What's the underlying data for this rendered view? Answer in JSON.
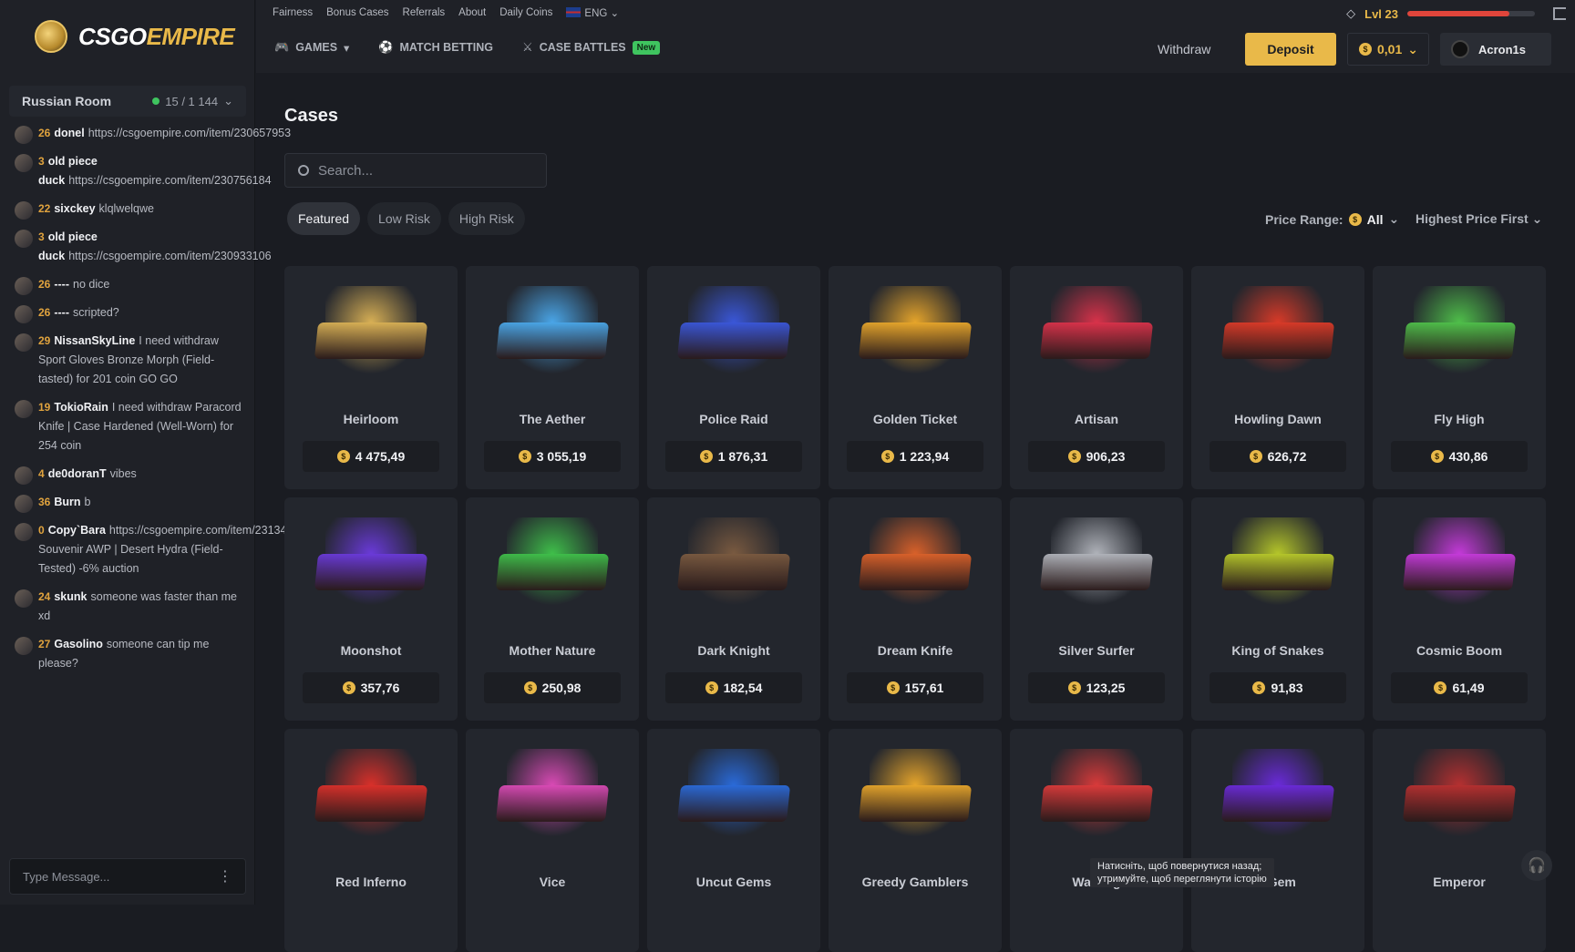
{
  "brand": {
    "part1": "CSGO",
    "part2": "EMPIRE"
  },
  "room": {
    "name": "Russian Room",
    "count": "15 / 1 144"
  },
  "chat": [
    {
      "lvl": "26",
      "user": "donel",
      "text": "https://csgoempire.com/item/230657953"
    },
    {
      "lvl": "3",
      "user": "old piece duck",
      "text": "https://csgoempire.com/item/230756184"
    },
    {
      "lvl": "22",
      "user": "sixckey",
      "text": "klqlwelqwe"
    },
    {
      "lvl": "3",
      "user": "old piece duck",
      "text": "https://csgoempire.com/item/230933106"
    },
    {
      "lvl": "26",
      "user": "----",
      "text": "no dice"
    },
    {
      "lvl": "26",
      "user": "----",
      "text": "scripted?"
    },
    {
      "lvl": "29",
      "user": "NissanSkyLine",
      "text": "I need withdraw Sport Gloves Bronze Morph (Field-tasted) for 201 coin GO GO"
    },
    {
      "lvl": "19",
      "user": "TokioRain",
      "text": "I need withdraw Paracord Knife | Case Hardened (Well-Worn) for 254 coin"
    },
    {
      "lvl": "4",
      "user": "de0doranT",
      "text": "vibes"
    },
    {
      "lvl": "36",
      "user": "Burn",
      "text": "b"
    },
    {
      "lvl": "0",
      "user": "Copy`Bara",
      "text": "https://csgoempire.com/item/231349231 Souvenir AWP | Desert Hydra (Field-Tested) -6% auction"
    },
    {
      "lvl": "24",
      "user": "skunk",
      "text": "someone was faster than me xd"
    },
    {
      "lvl": "27",
      "user": "Gasolino",
      "text": "someone can tip me please?"
    }
  ],
  "chat_input": {
    "placeholder": "Type Message..."
  },
  "toplinks": [
    "Fairness",
    "Bonus Cases",
    "Referrals",
    "About",
    "Daily Coins"
  ],
  "lang": "ENG",
  "level": {
    "label": "Lvl 23",
    "progress": 0.8
  },
  "nav": {
    "games": "GAMES",
    "match": "MATCH BETTING",
    "battles": "CASE BATTLES",
    "new": "New"
  },
  "header": {
    "withdraw": "Withdraw",
    "deposit": "Deposit",
    "balance": "0,01",
    "username": "Acron1s"
  },
  "page": {
    "title": "Cases",
    "search_placeholder": "Search..."
  },
  "filters": [
    "Featured",
    "Low Risk",
    "High Risk"
  ],
  "price_range": {
    "label": "Price Range:",
    "value": "All"
  },
  "sort": "Highest Price First",
  "cases": [
    {
      "name": "Heirloom",
      "price": "4 475,49",
      "color": "#d8b055"
    },
    {
      "name": "The Aether",
      "price": "3 055,19",
      "color": "#4aa6e8"
    },
    {
      "name": "Police Raid",
      "price": "1 876,31",
      "color": "#3a57d9"
    },
    {
      "name": "Golden Ticket",
      "price": "1 223,94",
      "color": "#e6a52b"
    },
    {
      "name": "Artisan",
      "price": "906,23",
      "color": "#d9324a"
    },
    {
      "name": "Howling Dawn",
      "price": "626,72",
      "color": "#d93a28"
    },
    {
      "name": "Fly High",
      "price": "430,86",
      "color": "#4fbf4a"
    },
    {
      "name": "Moonshot",
      "price": "357,76",
      "color": "#6a3ad9"
    },
    {
      "name": "Mother Nature",
      "price": "250,98",
      "color": "#3fbf4a"
    },
    {
      "name": "Dark Knight",
      "price": "182,54",
      "color": "#7a5a40"
    },
    {
      "name": "Dream Knife",
      "price": "157,61",
      "color": "#d9612a"
    },
    {
      "name": "Silver Surfer",
      "price": "123,25",
      "color": "#b0b3ba"
    },
    {
      "name": "King of Snakes",
      "price": "91,83",
      "color": "#b5c62a"
    },
    {
      "name": "Cosmic Boom",
      "price": "61,49",
      "color": "#c43ad9"
    },
    {
      "name": "Red Inferno",
      "price": "",
      "color": "#d9302a"
    },
    {
      "name": "Vice",
      "price": "",
      "color": "#d94ab5"
    },
    {
      "name": "Uncut Gems",
      "price": "",
      "color": "#2a6ad9"
    },
    {
      "name": "Greedy Gamblers",
      "price": "",
      "color": "#e6a52b"
    },
    {
      "name": "Walking",
      "price": "",
      "color": "#d93a3a"
    },
    {
      "name": "t Gem",
      "price": "",
      "color": "#6a2ad9"
    },
    {
      "name": "Emperor",
      "price": "",
      "color": "#b53030"
    }
  ],
  "tooltip": {
    "line1": "Натисніть, щоб повернутися назад;",
    "line2": "утримуйте, щоб переглянути історію"
  }
}
